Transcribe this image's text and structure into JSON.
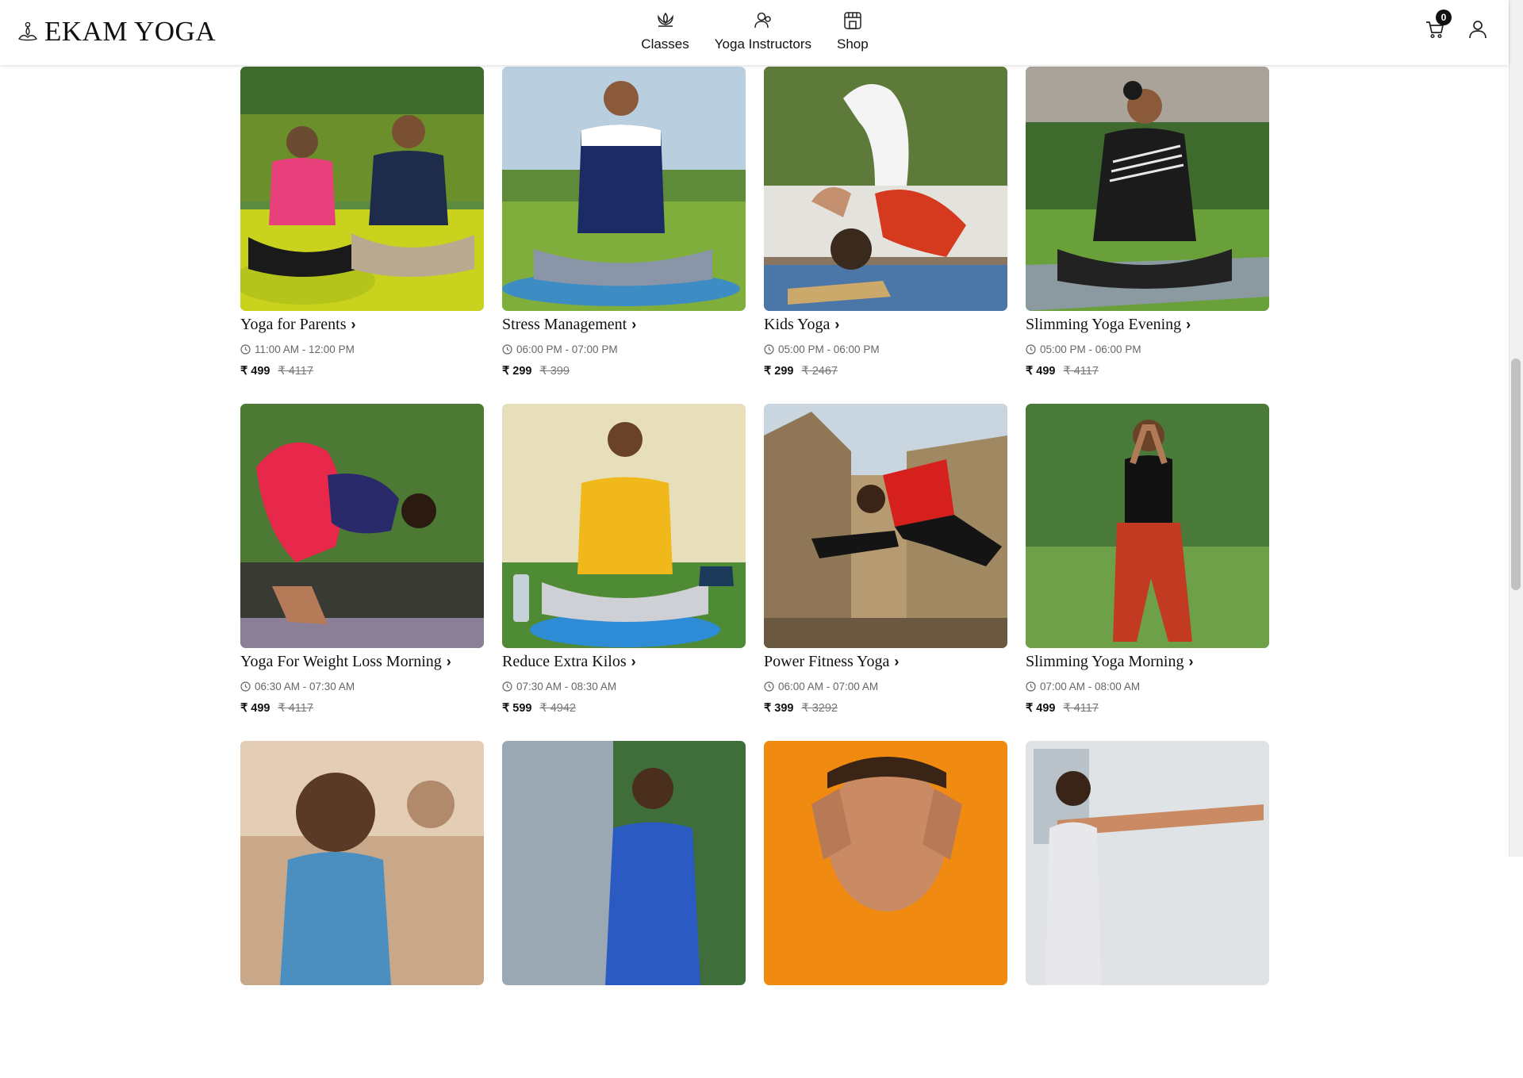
{
  "brand": {
    "name": "EKAM YOGA",
    "logo_icon": "lotus-figure-icon"
  },
  "nav": [
    {
      "label": "Classes",
      "icon": "lotus-icon"
    },
    {
      "label": "Yoga Instructors",
      "icon": "instructor-icon"
    },
    {
      "label": "Shop",
      "icon": "shop-icon"
    }
  ],
  "cart": {
    "count": "0",
    "icon": "cart-icon"
  },
  "profile": {
    "icon": "user-icon"
  },
  "classes": [
    {
      "title": "Yoga for Parents",
      "time": "11:00 AM - 12:00 PM",
      "price": "₹ 499",
      "old_price": "₹ 4117"
    },
    {
      "title": "Stress Management",
      "time": "06:00 PM - 07:00 PM",
      "price": "₹ 299",
      "old_price": "₹ 399"
    },
    {
      "title": "Kids Yoga",
      "time": "05:00 PM - 06:00 PM",
      "price": "₹ 299",
      "old_price": "₹ 2467"
    },
    {
      "title": "Slimming Yoga Evening",
      "time": "05:00 PM - 06:00 PM",
      "price": "₹ 499",
      "old_price": "₹ 4117"
    },
    {
      "title": "Yoga For Weight Loss Morning",
      "time": "06:30 AM - 07:30 AM",
      "price": "₹ 499",
      "old_price": "₹ 4117"
    },
    {
      "title": "Reduce Extra Kilos",
      "time": "07:30 AM - 08:30 AM",
      "price": "₹ 599",
      "old_price": "₹ 4942"
    },
    {
      "title": "Power Fitness Yoga",
      "time": "06:00 AM - 07:00 AM",
      "price": "₹ 399",
      "old_price": "₹ 3292"
    },
    {
      "title": "Slimming Yoga Morning",
      "time": "07:00 AM - 08:00 AM",
      "price": "₹ 499",
      "old_price": "₹ 4117"
    },
    {
      "title": "",
      "time": "",
      "price": "",
      "old_price": ""
    },
    {
      "title": "",
      "time": "",
      "price": "",
      "old_price": ""
    },
    {
      "title": "",
      "time": "",
      "price": "",
      "old_price": ""
    },
    {
      "title": "",
      "time": "",
      "price": "",
      "old_price": ""
    }
  ]
}
